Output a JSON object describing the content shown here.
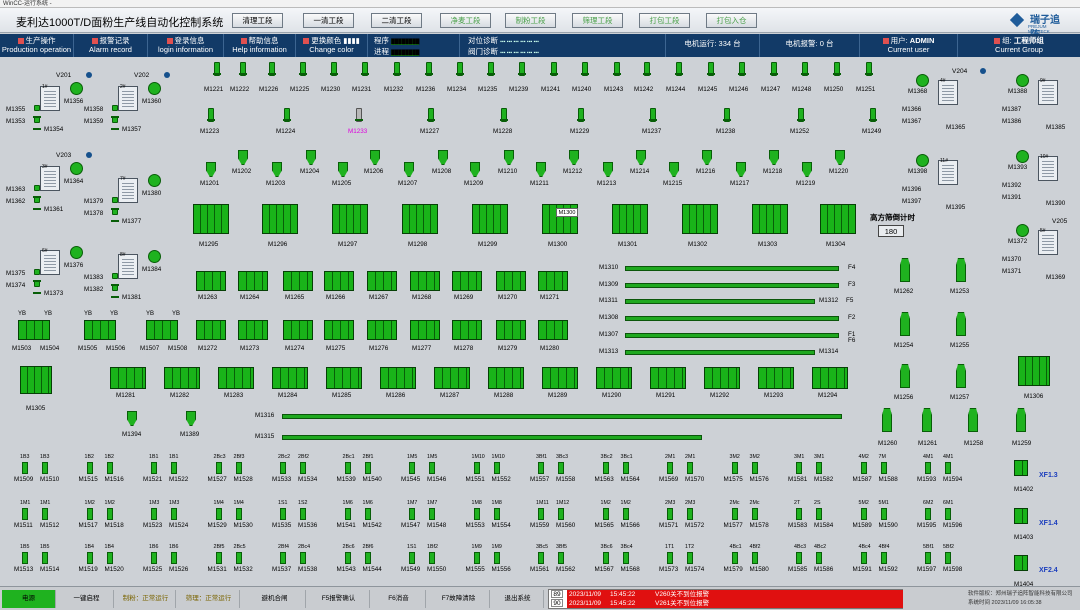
{
  "window_title": "WinCC-运行系统 -",
  "header": {
    "title": "麦利达1000T/D面粉生产线自动化控制系统",
    "stages": [
      "清理工段",
      "一清工段",
      "二清工段",
      "净麦工段",
      "制粉工段",
      "筛理工段",
      "打包工段",
      "打包入仓"
    ],
    "logo_name": "瑞子追阵",
    "logo_sub": "PREJUM MAXTECK"
  },
  "menu": {
    "items": [
      {
        "cn": "生产操作",
        "en": "Production operation"
      },
      {
        "cn": "报警记录",
        "en": "Alarm record"
      },
      {
        "cn": "登录信息",
        "en": "login information"
      },
      {
        "cn": "帮助信息",
        "en": "Help information"
      },
      {
        "cn": "更换颜色",
        "en": "Change color"
      }
    ],
    "program_label": "程序",
    "process_label": "进程",
    "align_check": "对位诊断",
    "valve_check": "阀门诊断",
    "motor_running_label": "电机运行:",
    "motor_running_value": "334",
    "motor_running_unit": "台",
    "motor_alarm_label": "电机报警:",
    "motor_alarm_value": "0",
    "motor_alarm_unit": "台",
    "user_label": "用户:",
    "user_name": "ADMIN",
    "user_en": "Current user",
    "group_label": "组:",
    "group_name": "工程师组",
    "group_en": "Current Group"
  },
  "left_bins": [
    {
      "valve": "V201",
      "bin": "1#",
      "fan": "M1356",
      "m1": "M1355",
      "m2": "M1353",
      "m3": "M1354"
    },
    {
      "valve": "V202",
      "bin": "2#",
      "fan": "M1360",
      "m1": "M1358",
      "m2": "M1359",
      "m3": "M1357"
    },
    {
      "valve": "V203",
      "bin": "3#",
      "fan": "M1364",
      "m1": "M1363",
      "m2": "M1362",
      "m3": "M1361"
    },
    {
      "valve": "",
      "bin": "7#",
      "fan": "M1380",
      "m1": "M1379",
      "m2": "M1378",
      "m3": "M1377"
    },
    {
      "valve": "",
      "bin": "6#",
      "fan": "M1376",
      "m1": "M1375",
      "m2": "M1374",
      "m3": "M1373"
    },
    {
      "valve": "",
      "bin": "8#",
      "fan": "M1384",
      "m1": "M1383",
      "m2": "M1382",
      "m3": "M1381"
    }
  ],
  "right_bins": [
    {
      "valve": "V204",
      "bin": "4#",
      "fan": "M1368",
      "m1": "M1366",
      "m2": "M1367",
      "m3": "M1365"
    },
    {
      "valve": "",
      "bin": "9#",
      "fan": "M1388",
      "m1": "M1387",
      "m2": "M1386",
      "m3": "M1385"
    },
    {
      "valve": "",
      "bin": "11#",
      "fan": "M1398",
      "m1": "M1396",
      "m2": "M1397",
      "m3": "M1395"
    },
    {
      "valve": "",
      "bin": "10#",
      "fan": "M1393",
      "m1": "M1392",
      "m2": "M1391",
      "m3": "M1390"
    },
    {
      "valve": "V205",
      "bin": "5#",
      "fan": "M1372",
      "m1": "M1370",
      "m2": "M1371",
      "m3": "M1369"
    }
  ],
  "row1": [
    "M1221",
    "M1222",
    "M1226",
    "M1225",
    "M1230",
    "M1231",
    "M1232",
    "M1236",
    "M1234",
    "M1235",
    "M1239",
    "M1241",
    "M1240",
    "M1243",
    "M1242",
    "M1244",
    "M1245",
    "M1246",
    "M1247",
    "M1248",
    "M1250",
    "M1251"
  ],
  "row2": [
    "M1223",
    "M1224",
    "M1233",
    "M1227",
    "M1228",
    "M1229",
    "M1237",
    "M1238",
    "M1252",
    "M1249"
  ],
  "row3": [
    "M1201",
    "M1202",
    "M1203",
    "M1204",
    "M1205",
    "M1206",
    "M1207",
    "M1208",
    "M1209",
    "M1210",
    "M1211",
    "M1212",
    "M1213",
    "M1214",
    "M1215",
    "M1216",
    "M1217",
    "M1218",
    "M1219",
    "M1220"
  ],
  "sifters": [
    "M1295",
    "M1296",
    "M1297",
    "M1298",
    "M1299",
    "M1300",
    "M1301",
    "M1302",
    "M1303",
    "M1304"
  ],
  "sifter_popup": "M1300",
  "timer_label": "高方筛倒计时",
  "timer_value": "180",
  "rolls_a": [
    "M1263",
    "M1264",
    "M1265",
    "M1266",
    "M1267",
    "M1268",
    "M1269",
    "M1270",
    "M1271"
  ],
  "rolls_b": [
    "M1272",
    "M1273",
    "M1274",
    "M1275",
    "M1276",
    "M1277",
    "M1278",
    "M1279",
    "M1280"
  ],
  "conveyors": [
    {
      "name": "M1310",
      "tag": "F4"
    },
    {
      "name": "M1309",
      "tag": "F3"
    },
    {
      "name": "M1311",
      "tag": "F5",
      "end": "M1312"
    },
    {
      "name": "M1308",
      "tag": "F2"
    },
    {
      "name": "M1307",
      "tag": "F1"
    },
    {
      "name": "M1313",
      "tag": "",
      "end": "M1314",
      "end_tag": "F6"
    }
  ],
  "yb_units": [
    {
      "a": "M1503",
      "b": "M1504"
    },
    {
      "a": "M1505",
      "b": "M1506"
    },
    {
      "a": "M1507",
      "b": "M1508"
    }
  ],
  "yb_label": "YB",
  "m1305": "M1305",
  "m1306": "M1306",
  "purifiers": [
    "M1281",
    "M1282",
    "M1283",
    "M1284",
    "M1285",
    "M1286",
    "M1287",
    "M1288",
    "M1289",
    "M1290",
    "M1291",
    "M1292",
    "M1293",
    "M1294"
  ],
  "m1394": "M1394",
  "m1389": "M1389",
  "long_conveyors": [
    "M1316",
    "M1315"
  ],
  "right_pumps": [
    {
      "a": "M1262",
      "b": "M1253"
    },
    {
      "a": "M1254",
      "b": "M1255"
    },
    {
      "a": "M1256",
      "b": "M1257"
    }
  ],
  "right_bottom": [
    "M1260",
    "M1261",
    "M1258",
    "M1259"
  ],
  "packers": [
    [
      [
        "1B3",
        "1B3",
        "M1509",
        "M1510"
      ],
      [
        "1B2",
        "1B2",
        "M1515",
        "M1516"
      ],
      [
        "1B1",
        "1B1",
        "M1521",
        "M1522"
      ],
      [
        "2Bc3",
        "2Bf3",
        "M1527",
        "M1528"
      ],
      [
        "2Bc2",
        "2Bf2",
        "M1533",
        "M1534"
      ],
      [
        "2Bc1",
        "2Bf1",
        "M1539",
        "M1540"
      ],
      [
        "1M5",
        "1M5",
        "M1545",
        "M1546"
      ],
      [
        "1M10",
        "1M10",
        "M1551",
        "M1552"
      ],
      [
        "3Bf1",
        "3Bc3",
        "M1557",
        "M1558"
      ],
      [
        "3Bc2",
        "3Bc1",
        "M1563",
        "M1564"
      ],
      [
        "2M1",
        "2M1",
        "M1569",
        "M1570"
      ],
      [
        "3M2",
        "3M2",
        "M1575",
        "M1576"
      ],
      [
        "3M1",
        "3M1",
        "M1581",
        "M1582"
      ],
      [
        "4M2",
        "7M",
        "M1587",
        "M1588"
      ],
      [
        "4M1",
        "4M1",
        "M1593",
        "M1594"
      ]
    ],
    [
      [
        "1M1",
        "1M1",
        "M1511",
        "M1512"
      ],
      [
        "1M2",
        "1M2",
        "M1517",
        "M1518"
      ],
      [
        "1M3",
        "1M3",
        "M1523",
        "M1524"
      ],
      [
        "1M4",
        "1M4",
        "M1529",
        "M1530"
      ],
      [
        "1S1",
        "1S2",
        "M1535",
        "M1536"
      ],
      [
        "1M6",
        "1M6",
        "M1541",
        "M1542"
      ],
      [
        "1M7",
        "1M7",
        "M1547",
        "M1548"
      ],
      [
        "1M8",
        "1M8",
        "M1553",
        "M1554"
      ],
      [
        "1M11",
        "1M12",
        "M1559",
        "M1560"
      ],
      [
        "1M2",
        "1M2",
        "M1565",
        "M1566"
      ],
      [
        "2M3",
        "2M3",
        "M1571",
        "M1572"
      ],
      [
        "2Mc",
        "2Mc",
        "M1577",
        "M1578"
      ],
      [
        "2T",
        "2S",
        "M1583",
        "M1584"
      ],
      [
        "5M2",
        "5M1",
        "M1589",
        "M1590"
      ],
      [
        "6M2",
        "6M1",
        "M1595",
        "M1596"
      ]
    ],
    [
      [
        "1B5",
        "1B5",
        "M1513",
        "M1514"
      ],
      [
        "1B4",
        "1B4",
        "M1519",
        "M1520"
      ],
      [
        "1B6",
        "1B6",
        "M1525",
        "M1526"
      ],
      [
        "2Bf5",
        "2Bc5",
        "M1531",
        "M1532"
      ],
      [
        "2Bf4",
        "2Bc4",
        "M1537",
        "M1538"
      ],
      [
        "2Bc6",
        "2Bf6",
        "M1543",
        "M1544"
      ],
      [
        "1S1",
        "1Bf2",
        "M1549",
        "M1550"
      ],
      [
        "1M9",
        "1M9",
        "M1555",
        "M1556"
      ],
      [
        "3Bc5",
        "3Bf5",
        "M1561",
        "M1562"
      ],
      [
        "3Bc6",
        "3Bc4",
        "M1567",
        "M1568"
      ],
      [
        "1T1",
        "1T2",
        "M1573",
        "M1574"
      ],
      [
        "4Bc1",
        "4Bf2",
        "M1579",
        "M1580"
      ],
      [
        "4Bc3",
        "4Bc2",
        "M1585",
        "M1586"
      ],
      [
        "4Bc4",
        "4Bf4",
        "M1591",
        "M1592"
      ],
      [
        "5Bf1",
        "5Bf2",
        "M1597",
        "M1598"
      ]
    ]
  ],
  "xf_units": [
    {
      "tag": "XF1.3",
      "motor": "M1402"
    },
    {
      "tag": "XF1.4",
      "motor": "M1403"
    },
    {
      "tag": "XF2.4",
      "motor": "M1404"
    }
  ],
  "status": {
    "buttons": [
      "电源",
      "一键启程",
      "制粉：正常运行",
      "筛理：正常运行",
      "避机合闸",
      "F5报警确认",
      "F6消音",
      "F7故障清除",
      "退出系统"
    ],
    "alarms": [
      {
        "no": "89",
        "date": "2023/11/09",
        "time": "15:45:22",
        "text": "V260关不到位报警"
      },
      {
        "no": "90",
        "date": "2023/11/09",
        "time": "15:45:22",
        "text": "V261关不到位报警"
      }
    ],
    "company": "软件版权：郑州瑞子追阵智能科技有限公司",
    "sysdate_label": "系统时间",
    "sysdate": "2023/11/09 16:05:38"
  },
  "colors": {
    "running": "#1fb21f",
    "menu": "#123a67",
    "alarm_bg": "#e01010"
  }
}
